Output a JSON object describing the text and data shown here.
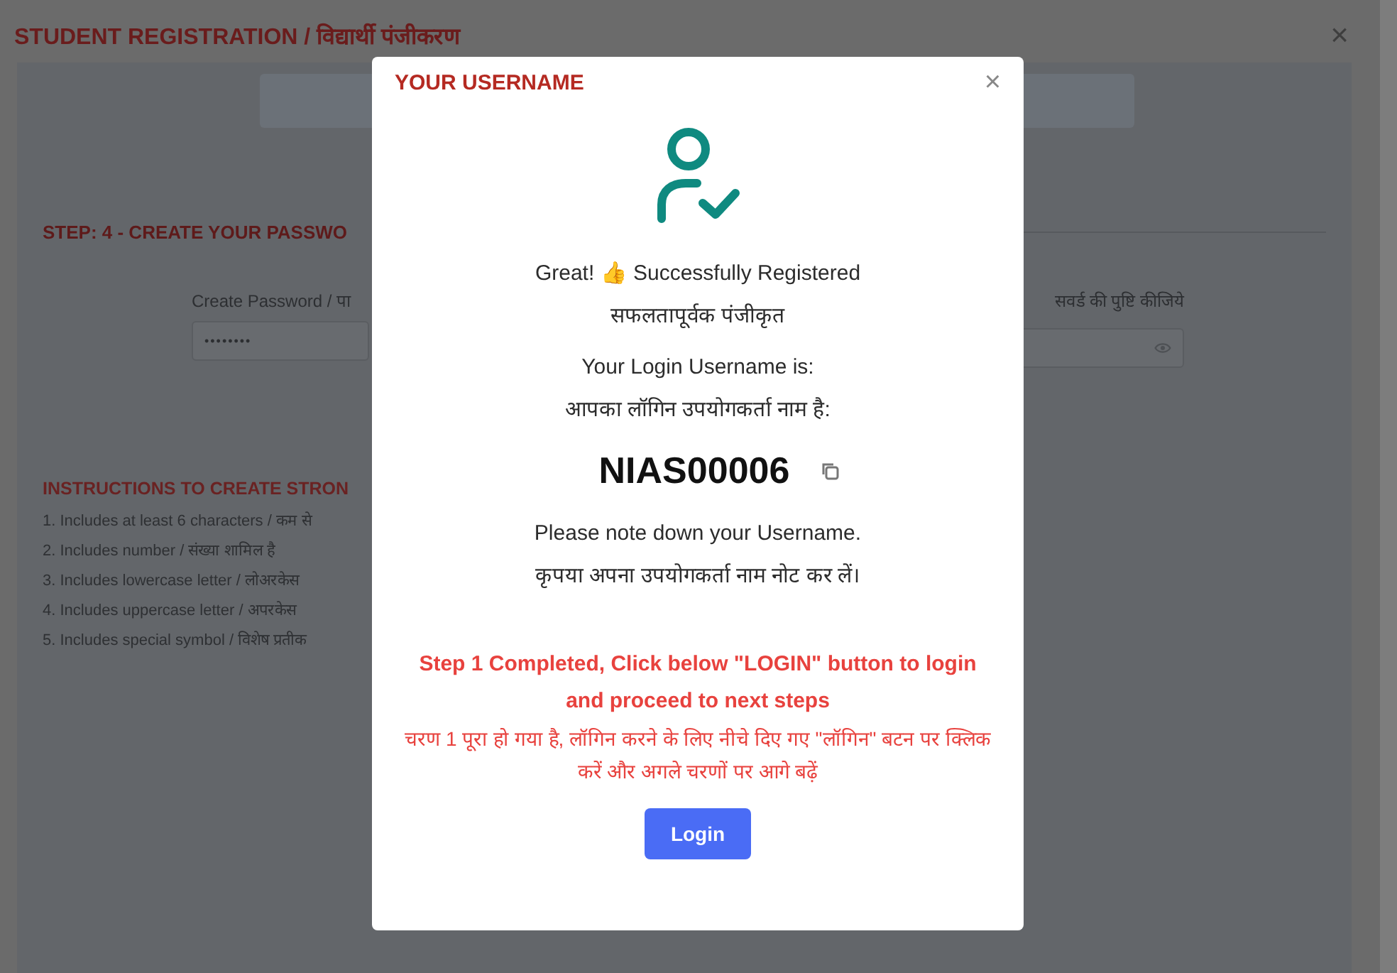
{
  "page": {
    "title": "STUDENT REGISTRATION / विद्यार्थी पंजीकरण",
    "close": "×",
    "step_heading": "STEP: 4 - CREATE YOUR PASSWO",
    "create_password": {
      "label": "Create Password / पा",
      "value": "••••••••"
    },
    "confirm_password": {
      "label": "सवर्ड की पुष्टि कीजिये"
    },
    "instructions_heading": "INSTRUCTIONS TO CREATE STRON",
    "instructions": [
      "1. Includes at least 6 characters / कम से",
      "2. Includes number / संख्या शामिल है",
      "3. Includes lowercase letter / लोअरकेस",
      "4. Includes uppercase letter / अपरकेस",
      "5. Includes special symbol / विशेष प्रतीक"
    ]
  },
  "dialog": {
    "title": "YOUR USERNAME",
    "close": "×",
    "success": [
      "Great! 👍 Successfully Registered",
      "सफलतापूर्वक पंजीकृत"
    ],
    "username_label": [
      "Your Login Username is:",
      "आपका लॉगिन उपयोगकर्ता नाम है:"
    ],
    "username": "NIAS00006",
    "note": [
      "Please note down your Username.",
      "कृपया अपना उपयोगकर्ता नाम नोट कर लें।"
    ],
    "notice": [
      "Step 1 Completed, Click below **\"LOGIN\"** button to login and proceed to next steps",
      "चरण 1 पूरा हो गया है, लॉगिन करने के लिए नीचे दिए गए \"लॉगिन\" बटन पर क्लिक करें और अगले चरणों पर आगे बढ़ें"
    ],
    "button": "Login"
  }
}
